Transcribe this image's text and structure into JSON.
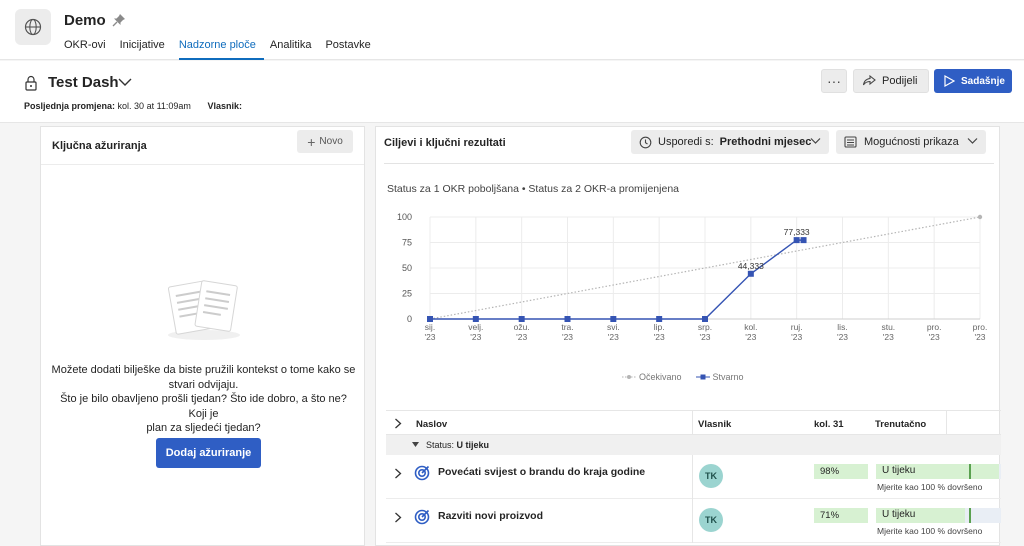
{
  "app": {
    "title": "Demo",
    "tabs": [
      "OKR-ovi",
      "Inicijative",
      "Nadzorne ploče",
      "Analitika",
      "Postavke"
    ],
    "active_tab": 2
  },
  "dashboard": {
    "title": "Test Dash",
    "last_change_label": "Posljednja promjena:",
    "last_change_value": "kol. 30 at 11:09am",
    "owner_label": "Vlasnik:",
    "more_label": "···",
    "share_label": "Podijeli",
    "present_label": "Sadašnje"
  },
  "left_panel": {
    "title": "Ključna ažuriranja",
    "new_label": "Novo",
    "empty_line1": "Možete dodati bilješke da biste pružili kontekst o tome kako se",
    "empty_line2": "stvari odvijaju.",
    "empty_line3": "Što je bilo obavljeno prošli tjedan? Što ide dobro, a što ne? Koji je",
    "empty_line4": "plan za sljedeći tjedan?",
    "add_label": "Dodaj ažuriranje"
  },
  "right_panel": {
    "title": "Ciljevi i ključni rezultati",
    "compare_label": "Usporedi s:",
    "compare_value": "Prethodni mjesec",
    "view_label": "Mogućnosti prikaza",
    "status_summary": "Status za 1 OKR poboljšana • Status za 2 OKR-a promijenjena"
  },
  "chart_data": {
    "type": "line",
    "categories": [
      "sij. '23",
      "velj. '23",
      "ožu. '23",
      "tra. '23",
      "svi. '23",
      "lip. '23",
      "srp. '23",
      "kol. '23",
      "ruj. '23",
      "lis. '23",
      "stu. '23",
      "pro. '23",
      "pro. '23"
    ],
    "ylim": [
      0,
      100
    ],
    "yticks": [
      0,
      25,
      50,
      75,
      100
    ],
    "grid": true,
    "legend_position": "bottom",
    "series": [
      {
        "name": "Očekivano",
        "color": "#b5b5b5",
        "style": "dotted",
        "points": [
          [
            0,
            0
          ],
          [
            12,
            100
          ]
        ]
      },
      {
        "name": "Stvarno",
        "color": "#3554b3",
        "style": "solid",
        "points": [
          [
            0,
            0
          ],
          [
            1,
            0
          ],
          [
            2,
            0
          ],
          [
            3,
            0
          ],
          [
            4,
            0
          ],
          [
            5,
            0
          ],
          [
            6,
            0
          ],
          [
            7,
            44.333
          ],
          [
            8,
            77.333
          ],
          [
            8.15,
            77.333
          ]
        ]
      }
    ],
    "data_labels": [
      {
        "text": "44,333",
        "x": 7,
        "y": 44.333
      },
      {
        "text": "77,333",
        "x": 8,
        "y": 77.333
      }
    ]
  },
  "table": {
    "headers": {
      "title": "Naslov",
      "owner": "Vlasnik",
      "week": "kol. 31",
      "current": "Trenutačno"
    },
    "group_prefix": "Status:",
    "group_value": "U tijeku",
    "rows": [
      {
        "title": "Povećati svijest o brandu do kraja godine",
        "avatar": "TK",
        "pct": "98%",
        "progress": 0.98,
        "status": "U tijeku",
        "measure": "Mjerite kao 100 % dovršeno"
      },
      {
        "title": "Razviti novi proizvod",
        "avatar": "TK",
        "pct": "71%",
        "progress": 0.71,
        "status": "U tijeku",
        "measure": "Mjerite kao 100 % dovršeno"
      }
    ]
  }
}
